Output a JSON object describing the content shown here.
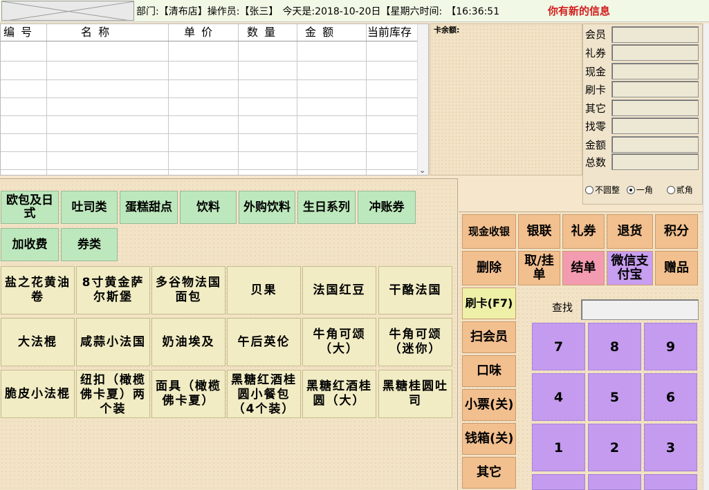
{
  "header": {
    "dept_label": "部门:",
    "dept_value": "【清布店】",
    "operator_label": "操作员:",
    "operator_value": "【张三】",
    "date_label": "今天是:",
    "date_value": "2018-10-20日",
    "weekday_text": "【星期六",
    "time_label": "时间:",
    "time_value": "【16:36:51",
    "message": "你有新的信息"
  },
  "grid": {
    "columns": [
      "编 号",
      "名 称",
      "单 价",
      "数 量",
      "金 额",
      "当前库存"
    ],
    "rows": []
  },
  "card": {
    "balance_label": "卡余额:"
  },
  "payment": {
    "fields": [
      {
        "label": "会员",
        "value": ""
      },
      {
        "label": "礼券",
        "value": ""
      },
      {
        "label": "现金",
        "value": ""
      },
      {
        "label": "刷卡",
        "value": ""
      },
      {
        "label": "其它",
        "value": ""
      },
      {
        "label": "找零",
        "value": ""
      },
      {
        "label": "金额",
        "value": ""
      },
      {
        "label": "总数",
        "value": ""
      }
    ],
    "rounding": {
      "options": [
        "不圆整",
        "一角",
        "贰角"
      ],
      "selected": "一角"
    }
  },
  "categories": [
    "欧包及日式",
    "吐司类",
    "蛋糕甜点",
    "饮料",
    "外购饮料",
    "生日系列",
    "冲账券",
    "加收费",
    "券类"
  ],
  "products": [
    "盐之花黄油卷",
    "8寸黄金萨尔斯堡",
    "多谷物法国面包",
    "贝果",
    "法国红豆",
    "干酪法国",
    "大法棍",
    "咸蒜小法国",
    "奶油埃及",
    "午后英伦",
    "牛角可颂（大）",
    "牛角可颂（迷你）",
    "脆皮小法棍",
    "纽扣（橄榄佛卡夏）两个装",
    "面具（橄榄佛卡夏）",
    "黑糖红酒桂圆小餐包（4个装）",
    "黑糖红酒桂圆（大）",
    "黑糖桂圆吐司"
  ],
  "actions": {
    "cash_checkout": "现金收银",
    "unionpay": "银联",
    "coupon": "礼券",
    "refund": "退货",
    "points": "积分",
    "delete": "删除",
    "take_hold": "取/挂单",
    "settle": "结单",
    "wechat_alipay": "微信支付宝",
    "gift": "赠品",
    "swipe_card": "刷卡(F7)",
    "scan_member": "扫会员",
    "flavor": "口味",
    "receipt": "小票(关)",
    "cash_drawer": "钱箱(关)",
    "other": "其它"
  },
  "search": {
    "label": "查找",
    "value": ""
  },
  "keypad": [
    "7",
    "8",
    "9",
    "4",
    "5",
    "6",
    "1",
    "2",
    "3"
  ],
  "colors": {
    "category_bg": "#bde8bd",
    "product_bg": "#f1ecc4",
    "action_bg": "#f2bf8f",
    "keypad_bg": "#c49bef",
    "settle_bg": "#f39bb0",
    "alert_text": "#d21c1c"
  }
}
